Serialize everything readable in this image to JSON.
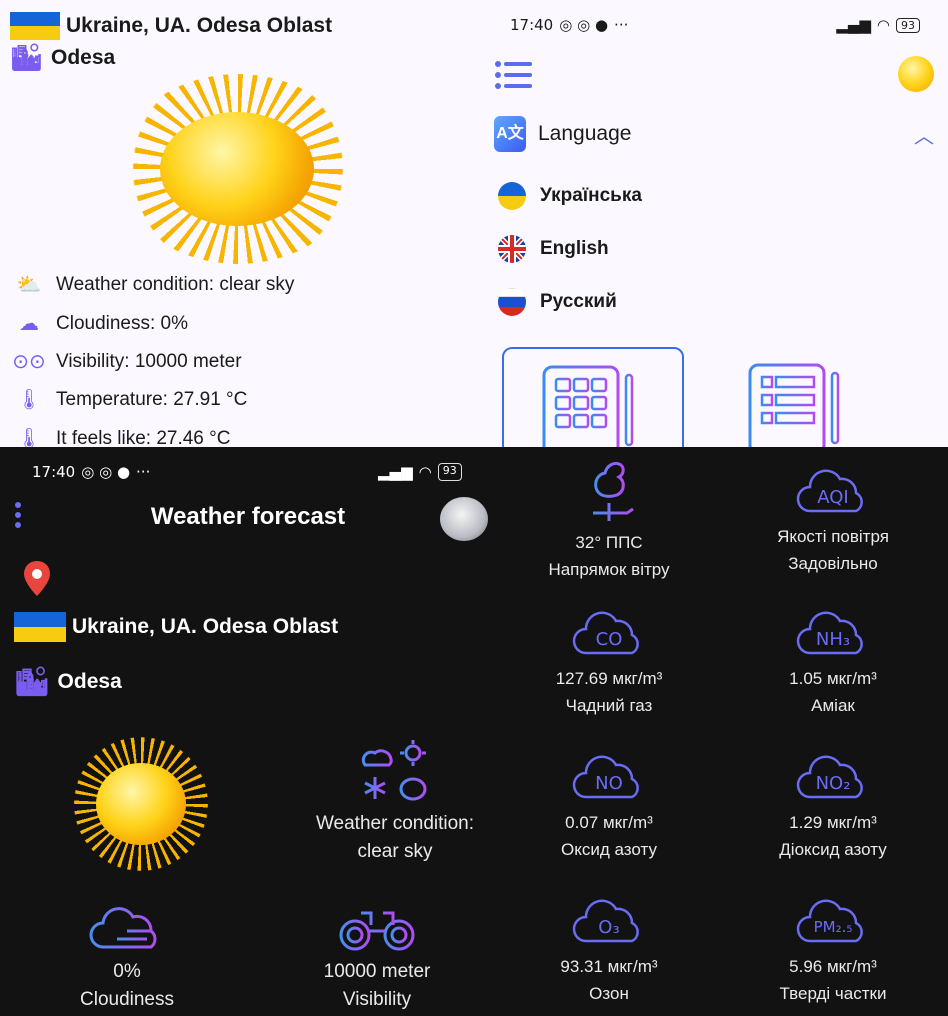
{
  "light": {
    "location": {
      "country_region": "Ukraine, UA. Odesa Oblast",
      "city": "Odesa"
    },
    "details": [
      {
        "icon": "weather-condition-icon",
        "text": "Weather condition:  clear sky"
      },
      {
        "icon": "cloudiness-icon",
        "text": "Cloudiness:  0%"
      },
      {
        "icon": "visibility-icon",
        "text": "Visibility:  10000 meter"
      },
      {
        "icon": "thermometer-icon",
        "text": "Temperature:  27.91 °C"
      },
      {
        "icon": "thermometer-icon",
        "text": "It feels like:  27.46 °C"
      }
    ],
    "status_bar": {
      "time": "17:40",
      "dots": "···",
      "battery": "93"
    },
    "menu": {
      "language_title": "Language",
      "languages": [
        "Українська",
        "English",
        "Русский"
      ]
    }
  },
  "dark": {
    "status_bar": {
      "time": "17:40",
      "dots": "···",
      "battery": "93"
    },
    "title": "Weather forecast",
    "location": {
      "country_region": "Ukraine, UA. Odesa Oblast",
      "city": "Odesa"
    },
    "condition": {
      "label": "Weather condition:",
      "value": "clear sky"
    },
    "cloudiness": {
      "value": "0%",
      "label": "Cloudiness"
    },
    "visibility": {
      "value": "10000 meter",
      "label": "Visibility"
    },
    "air": [
      {
        "icon_text": "",
        "value": "32° ППС",
        "label": "Напрямок вітру"
      },
      {
        "icon_text": "AQI",
        "value": "Якості повітря",
        "label": "Задовільно"
      },
      {
        "icon_text": "CO",
        "value": "127.69 мкг/m³",
        "label": "Чадний газ"
      },
      {
        "icon_text": "NH₃",
        "value": "1.05 мкг/m³",
        "label": "Аміак"
      },
      {
        "icon_text": "NO",
        "value": "0.07 мкг/m³",
        "label": "Оксид азоту"
      },
      {
        "icon_text": "NO₂",
        "value": "1.29 мкг/m³",
        "label": "Діоксид азоту"
      },
      {
        "icon_text": "O₃",
        "value": "93.31 мкг/m³",
        "label": "Озон"
      },
      {
        "icon_text": "PM₂.₅",
        "value": "5.96 мкг/m³",
        "label": "Тверді частки"
      }
    ]
  },
  "colors": {
    "accent": "#6a6cf5",
    "flag_blue": "#1565d8",
    "flag_yellow": "#f5cc10"
  }
}
